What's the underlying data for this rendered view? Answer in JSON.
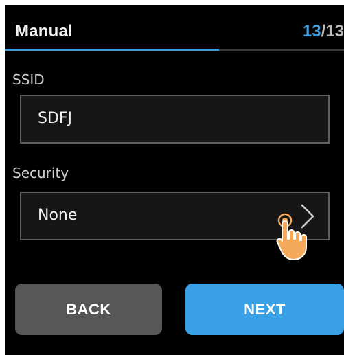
{
  "header": {
    "title": "Manual",
    "page_current": "13",
    "page_sep": "/",
    "page_total": "13",
    "progress_fraction": 0.63
  },
  "form": {
    "ssid_label": "SSID",
    "ssid_value": "SDFJ",
    "security_label": "Security",
    "security_value": "None",
    "security_icon": "chevron-right-icon",
    "pointer_icon": "tap-hand-icon"
  },
  "buttons": {
    "back_label": "BACK",
    "next_label": "NEXT"
  },
  "colors": {
    "accent": "#3aa0e6",
    "background": "#000000",
    "field_bg": "#161616",
    "field_border": "#5f5f5f",
    "back_button": "#575757",
    "hand": "#f5a95a"
  }
}
